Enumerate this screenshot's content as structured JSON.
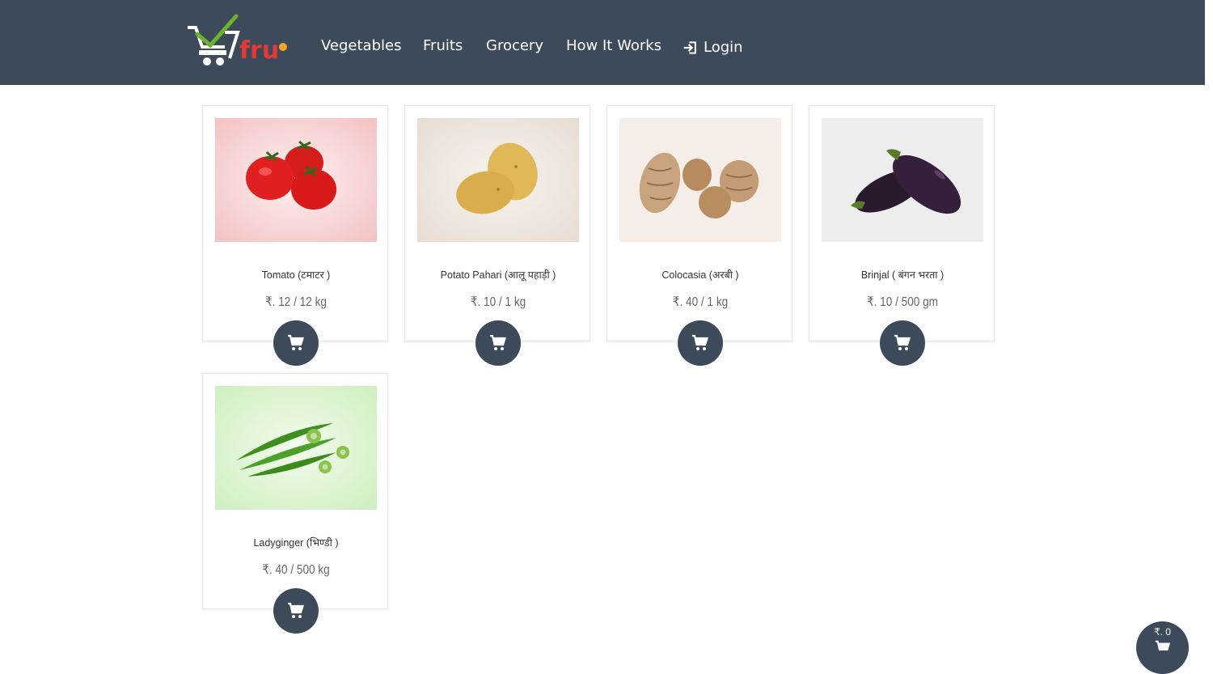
{
  "brand": {
    "name": "7fru"
  },
  "nav": {
    "items": [
      {
        "label": "Vegetables"
      },
      {
        "label": "Fruits"
      },
      {
        "label": "Grocery"
      },
      {
        "label": "How It Works"
      }
    ],
    "login_label": "Login"
  },
  "products": [
    {
      "name": "Tomato (टमाटर )",
      "price": "₹. 12 / 12 kg",
      "image": "tomato"
    },
    {
      "name": "Potato Pahari (आलू पहाड़ी )",
      "price": "₹. 10 / 1 kg",
      "image": "potato"
    },
    {
      "name": "Colocasia (अरबी )",
      "price": "₹. 40 / 1 kg",
      "image": "colocasia"
    },
    {
      "name": "Brinjal ( बंगन भरता )",
      "price": "₹. 10 / 500 gm",
      "image": "brinjal"
    },
    {
      "name": "Ladyginger (भिण्डी )",
      "price": "₹. 40 / 500 kg",
      "image": "ladyfinger"
    }
  ],
  "cart": {
    "total": "₹. 0"
  },
  "colors": {
    "navbar": "#3d4a59",
    "accent_green": "#6ab42d",
    "accent_red": "#e53935"
  }
}
